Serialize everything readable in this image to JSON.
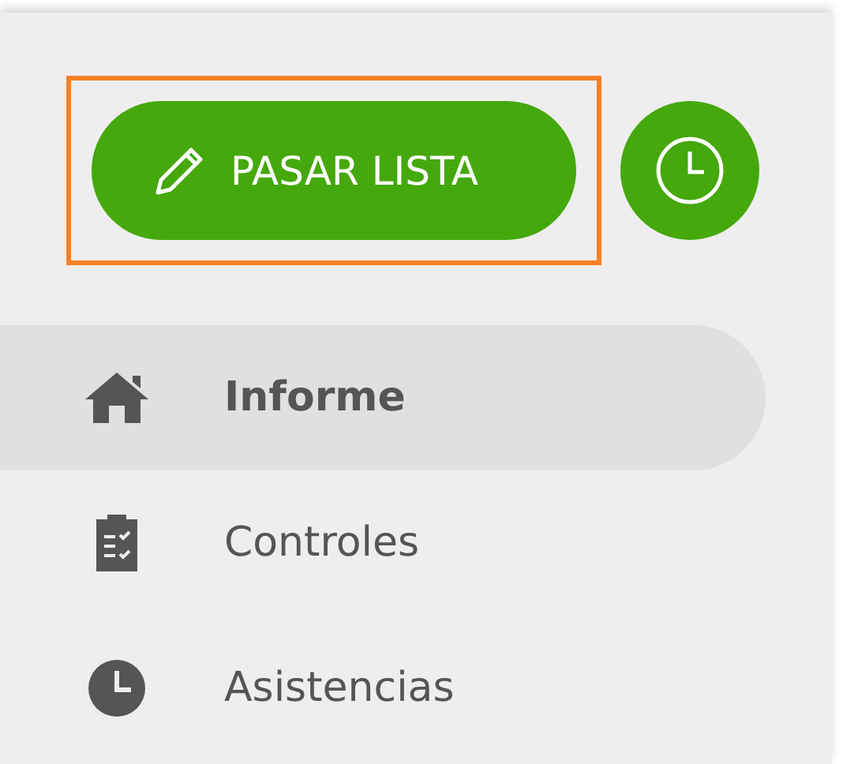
{
  "action_button": {
    "label": "PASAR LISTA",
    "highlighted": true
  },
  "nav_items": [
    {
      "label": "Informe",
      "kind": "home",
      "selected": true
    },
    {
      "label": "Controles",
      "kind": "clipboard",
      "selected": false
    },
    {
      "label": "Asistencias",
      "kind": "clock",
      "selected": false
    }
  ]
}
